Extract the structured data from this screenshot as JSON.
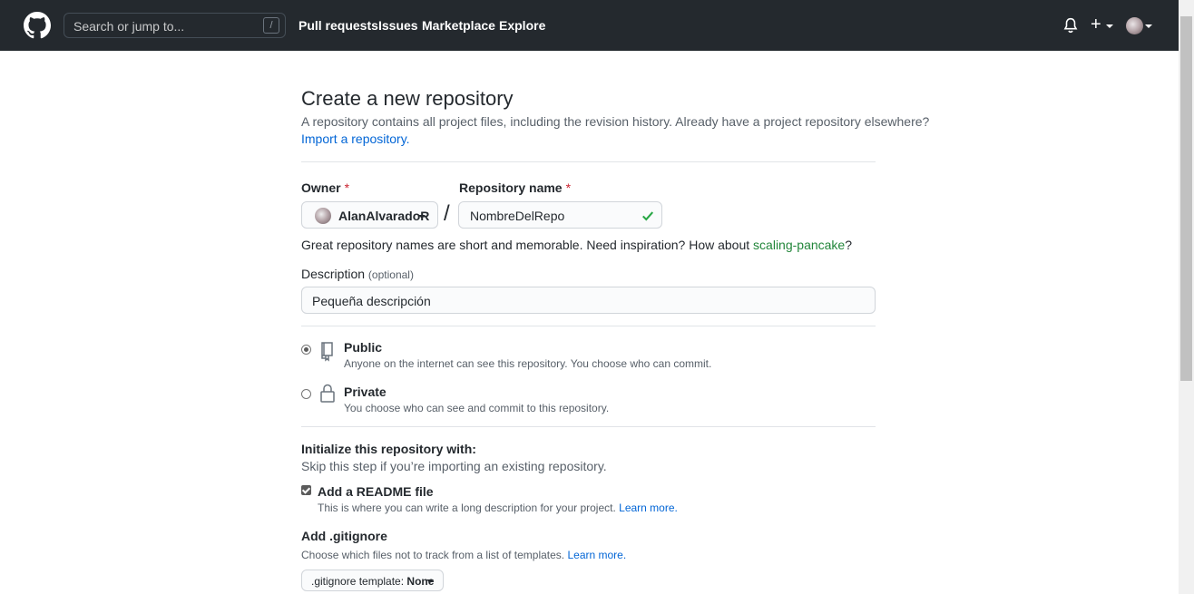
{
  "header": {
    "search_placeholder": "Search or jump to...",
    "search_shortcut": "/",
    "nav": [
      "Pull requests",
      "Issues",
      "Marketplace",
      "Explore"
    ],
    "plus": "+"
  },
  "page": {
    "title": "Create a new repository",
    "subtitle": "A repository contains all project files, including the revision history. Already have a project repository elsewhere?",
    "import_link": "Import a repository.",
    "owner_label": "Owner",
    "required_mark": "*",
    "owner_name": "AlanAlvaradoR",
    "separator": "/",
    "repo_label": "Repository name",
    "repo_value": "NombreDelRepo",
    "hint_text": "Great repository names are short and memorable. Need inspiration? How about ",
    "hint_suggestion": "scaling-pancake",
    "hint_end": "?",
    "description_label": "Description",
    "description_optional": "(optional)",
    "description_value": "Pequeña descripción"
  },
  "visibility": {
    "selected": "public",
    "public": {
      "title": "Public",
      "note": "Anyone on the internet can see this repository. You choose who can commit."
    },
    "private": {
      "title": "Private",
      "note": "You choose who can see and commit to this repository."
    }
  },
  "initialize": {
    "title": "Initialize this repository with:",
    "note": "Skip this step if you’re importing an existing repository.",
    "readme_checked": true,
    "readme_label": "Add a README file",
    "readme_note": "This is where you can write a long description for your project. ",
    "learn_more": "Learn more.",
    "gitignore_title": "Add .gitignore",
    "gitignore_note": "Choose which files not to track from a list of templates. ",
    "gitignore_button_prefix": ".gitignore template: ",
    "gitignore_button_value": "None"
  },
  "colors": {
    "header_bg": "#24292e",
    "link": "#0366d6",
    "success": "#22863a",
    "required": "#cb2431"
  },
  "icons": [
    "github-logo-icon",
    "bell-icon",
    "plus-icon",
    "check-icon",
    "repo-icon",
    "lock-icon"
  ]
}
